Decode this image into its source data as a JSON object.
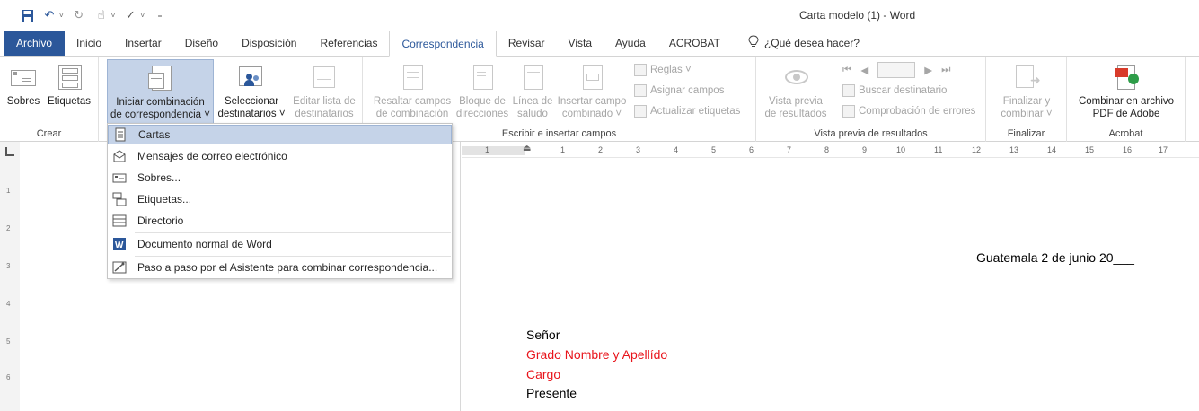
{
  "window": {
    "title": "Carta modelo (1)  -  Word"
  },
  "tabs": [
    {
      "label": "Archivo"
    },
    {
      "label": "Inicio"
    },
    {
      "label": "Insertar"
    },
    {
      "label": "Diseño"
    },
    {
      "label": "Disposición"
    },
    {
      "label": "Referencias"
    },
    {
      "label": "Correspondencia"
    },
    {
      "label": "Revisar"
    },
    {
      "label": "Vista"
    },
    {
      "label": "Ayuda"
    },
    {
      "label": "ACROBAT"
    }
  ],
  "tellme": {
    "label": "¿Qué desea hacer?"
  },
  "ribbon": {
    "crear": {
      "label": "Crear",
      "sobres": "Sobres",
      "etiquetas": "Etiquetas"
    },
    "iniciar": {
      "label1": "Iniciar combinación",
      "label2": "de correspondencia ˅"
    },
    "seleccionar": {
      "label1": "Seleccionar",
      "label2": "destinatarios ˅"
    },
    "editar": {
      "label1": "Editar lista de",
      "label2": "destinatarios"
    },
    "escribir": {
      "label": "Escribir e insertar campos",
      "resaltar1": "Resaltar campos",
      "resaltar2": "de combinación",
      "bloque1": "Bloque de",
      "bloque2": "direcciones",
      "linea1": "Línea de",
      "linea2": "saludo",
      "insertar1": "Insertar campo",
      "insertar2": "combinado ˅",
      "reglas": "Reglas ˅",
      "asignar": "Asignar campos",
      "actualizar": "Actualizar etiquetas"
    },
    "vista": {
      "label": "Vista previa de resultados",
      "vista1": "Vista previa",
      "vista2": "de resultados",
      "buscar": "Buscar destinatario",
      "comprobar": "Comprobación de errores"
    },
    "finalizar": {
      "label": "Finalizar",
      "btn1": "Finalizar y",
      "btn2": "combinar ˅"
    },
    "acrobat": {
      "label": "Acrobat",
      "btn1": "Combinar en archivo",
      "btn2": "PDF de Adobe"
    }
  },
  "menu": {
    "items": [
      {
        "label": "Cartas"
      },
      {
        "label": "Mensajes de correo electrónico"
      },
      {
        "label": "Sobres..."
      },
      {
        "label": "Etiquetas..."
      },
      {
        "label": "Directorio"
      },
      {
        "label": "Documento normal de Word"
      },
      {
        "label": "Paso a paso por el Asistente para combinar correspondencia..."
      }
    ]
  },
  "ruler": {
    "h": [
      "1",
      "1",
      "2",
      "3",
      "4",
      "5",
      "6",
      "7",
      "8",
      "9",
      "10",
      "11",
      "12",
      "13",
      "14",
      "15",
      "16",
      "17"
    ],
    "v": [
      "1",
      "2",
      "3",
      "4",
      "5",
      "6"
    ]
  },
  "document": {
    "date": "Guatemala 2 de junio 20___",
    "line1": "Señor",
    "line2": "Grado Nombre y Apellído",
    "line3": "Cargo",
    "line4": "Presente",
    "colors": {
      "black": "#000000",
      "red": "#e8141b"
    }
  },
  "colors": {
    "accent": "#2b579a",
    "highlight": "#c5d3e8"
  }
}
